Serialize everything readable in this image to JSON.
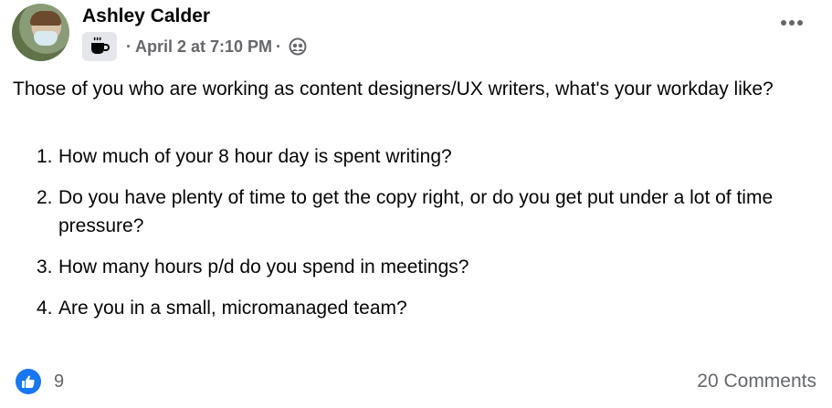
{
  "post": {
    "author": "Ashley Calder",
    "timestamp": "April 2 at 7:10 PM",
    "separator": "·",
    "badge_icon": "coffee-cup-icon",
    "audience_icon": "friends-icon",
    "body": "Those of you who are working as content designers/UX writers, what's your workday like?",
    "questions": [
      {
        "num": "1.",
        "text": "How much of your 8 hour day is spent writing?"
      },
      {
        "num": "2.",
        "text": "Do you have plenty of time to get the copy right, or do you get put under a lot of time pressure?"
      },
      {
        "num": "3.",
        "text": "How many hours p/d do you spend in meetings?"
      },
      {
        "num": "4.",
        "text": "Are you in a small, micromanaged team?"
      }
    ]
  },
  "footer": {
    "like_count": "9",
    "comments_label": "20 Comments"
  },
  "colors": {
    "text": "#050505",
    "secondary": "#65676b",
    "like_blue": "#1877f2",
    "badge_bg": "#e4e6eb"
  }
}
